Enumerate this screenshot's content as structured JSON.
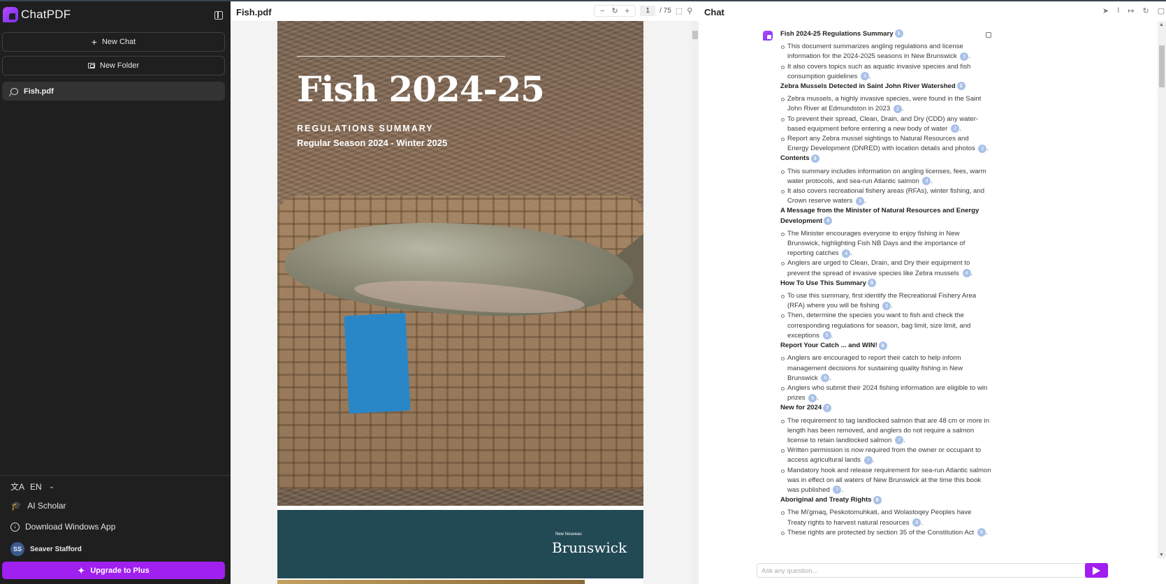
{
  "sidebar": {
    "brand": "ChatPDF",
    "new_chat": "New Chat",
    "new_chat_icon": "+",
    "new_folder": "New Folder",
    "chats": [
      {
        "label": "Fish.pdf"
      }
    ],
    "language": "EN",
    "lang_icon": "文A",
    "chevron": "⌄",
    "ai_scholar": "AI Scholar",
    "scholar_icon": "🎓",
    "download": "Download Windows App",
    "download_icon": "↓",
    "user": {
      "initials": "SS",
      "name": "Seaver Stafford"
    },
    "upgrade": "Upgrade to Plus",
    "upgrade_icon": "✦",
    "accent": "#a020f0"
  },
  "pdf": {
    "title": "Fish.pdf",
    "zoom_out": "−",
    "reset": "↻",
    "zoom_in": "+",
    "page": "1",
    "total": "/ 75",
    "scan_icon": "⬚",
    "search_icon": "⚲",
    "cover": {
      "title": "Fish 2024-25",
      "subtitle": "REGULATIONS SUMMARY",
      "season": "Regular Season 2024 - Winter 2025",
      "logo_small": "New  Nouveau",
      "logo": "Brunswick"
    }
  },
  "chat": {
    "title": "Chat",
    "tools": [
      "➤",
      "I",
      "↦",
      "↻",
      "▢"
    ],
    "input_placeholder": "Ask any question...",
    "sections": [
      {
        "title": "Fish 2024-25 Regulations Summary",
        "cite": "1",
        "items": [
          {
            "text": "This document summarizes angling regulations and license information for the 2024-2025 seasons in New Brunswick",
            "cite": "1"
          },
          {
            "text": "It also covers topics such as aquatic invasive species and fish consumption guidelines",
            "cite": "3"
          }
        ]
      },
      {
        "title": "Zebra Mussels Detected in Saint John River Watershed",
        "cite": "2",
        "items": [
          {
            "text": "Zebra mussels, a highly invasive species, were found in the Saint John River at Edmundston in 2023",
            "cite": "2"
          },
          {
            "text": "To prevent their spread, Clean, Drain, and Dry (CDD) any water-based equipment before entering a new body of water",
            "cite": "2"
          },
          {
            "text": "Report any Zebra mussel sightings to Natural Resources and Energy Development (DNRED) with location details and photos",
            "cite": "2"
          }
        ]
      },
      {
        "title": "Contents",
        "cite": "3",
        "items": [
          {
            "text": "This summary includes information on angling licenses, fees, warm water protocols, and sea-run Atlantic salmon",
            "cite": "3"
          },
          {
            "text": "It also covers recreational fishery areas (RFAs), winter fishing, and Crown reserve waters",
            "cite": "3"
          }
        ]
      },
      {
        "title": "A Message from the Minister of Natural Resources and Energy Development",
        "cite": "4",
        "items": [
          {
            "text": "The Minister encourages everyone to enjoy fishing in New Brunswick, highlighting Fish NB Days and the importance of reporting catches",
            "cite": "4"
          },
          {
            "text": "Anglers are urged to Clean, Drain, and Dry their equipment to prevent the spread of invasive species like Zebra mussels",
            "cite": "4"
          }
        ]
      },
      {
        "title": "How To Use This Summary",
        "cite": "5",
        "items": [
          {
            "text": "To use this summary, first identify the Recreational Fishery Area (RFA) where you will be fishing",
            "cite": "5"
          },
          {
            "text": "Then, determine the species you want to fish and check the corresponding regulations for season, bag limit, size limit, and exceptions",
            "cite": "5"
          }
        ]
      },
      {
        "title": "Report Your Catch ... and WIN!",
        "cite": "6",
        "items": [
          {
            "text": "Anglers are encouraged to report their catch to help inform management decisions for sustaining quality fishing in New Brunswick",
            "cite": "6"
          },
          {
            "text": "Anglers who submit their 2024 fishing information are eligible to win prizes",
            "cite": "6"
          }
        ]
      },
      {
        "title": "New for 2024",
        "cite": "7",
        "items": [
          {
            "text": "The requirement to tag landlocked salmon that are 48 cm or more in length has been removed, and anglers do not require a salmon license to retain landlocked salmon",
            "cite": "7"
          },
          {
            "text": "Written permission is now required from the owner or occupant to access agricultural lands",
            "cite": "7"
          },
          {
            "text": "Mandatory hook and release requirement for sea-run Atlantic salmon was in effect on all waters of New Brunswick at the time this book was published",
            "cite": "7"
          }
        ]
      },
      {
        "title": "Aboriginal and Treaty Rights",
        "cite": "8",
        "items": [
          {
            "text": "The Mi'gmaq, Peskotomuhkati, and Wolastoqey Peoples have Treaty rights to harvest natural resources",
            "cite": "8"
          },
          {
            "text": "These rights are protected by section 35 of the Constitution Act",
            "cite": "8"
          }
        ]
      }
    ]
  }
}
